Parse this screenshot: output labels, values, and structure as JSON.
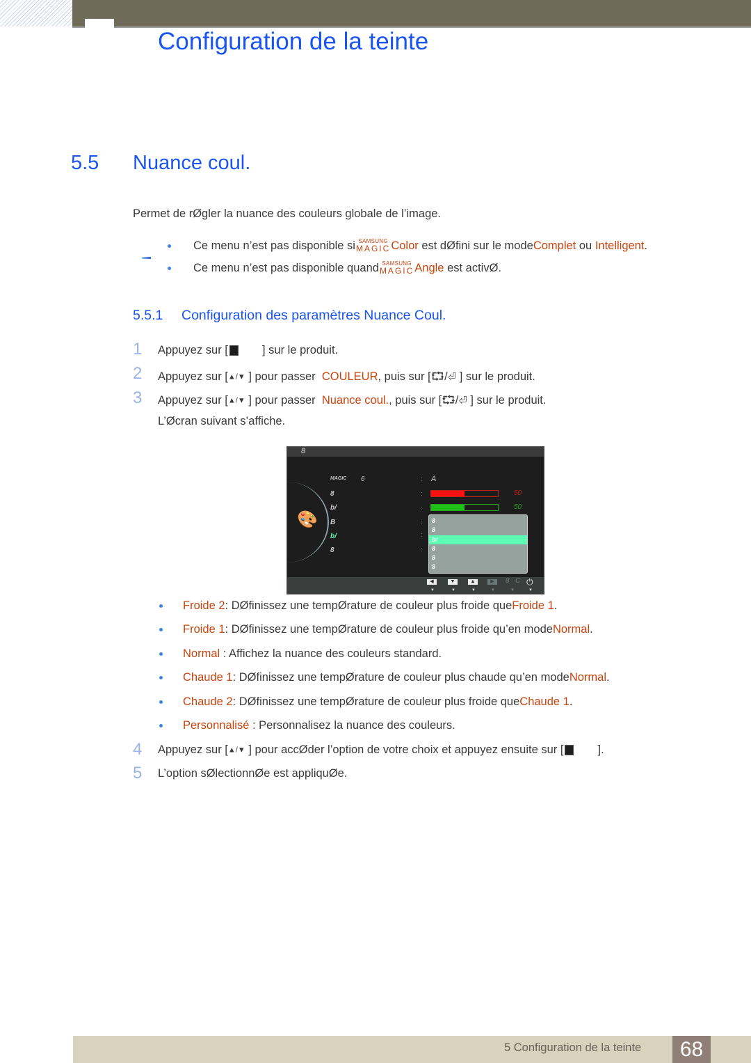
{
  "header": {
    "chapter_title": "Configuration de la teinte"
  },
  "section": {
    "number": "5.5",
    "title": "Nuance coul.",
    "intro": "Permet de rØgler la nuance des couleurs globale de l’image."
  },
  "notes": [
    {
      "pre": "Ce menu n’est pas disponible si",
      "magic_top": "SAMSUNG",
      "magic_bottom": "MAGIC",
      "feature": "Color",
      "mid": " est dØfini sur le mode",
      "opt1": "Complet",
      "between": " ou ",
      "opt2": "Intelligent",
      "end": "."
    },
    {
      "pre": "Ce menu n’est pas disponible quand",
      "magic_top": "SAMSUNG",
      "magic_bottom": "MAGIC",
      "feature": "Angle",
      "mid": " est activØ."
    }
  ],
  "subsection": {
    "number": "5.5.1",
    "title": "Configuration des paramètres Nuance Coul."
  },
  "steps": [
    {
      "num": "1",
      "pre": "Appuyez sur [",
      "post": "       ] sur le produit."
    },
    {
      "num": "2",
      "pre": "Appuyez sur [",
      "mid": "] pour passer ",
      "hl": "COULEUR",
      "post": ", puis sur [",
      "end": "] sur le produit."
    },
    {
      "num": "3",
      "pre": "Appuyez sur [",
      "mid": "] pour passer ",
      "hl": "Nuance coul.",
      "post": ", puis sur [",
      "end": "] sur le produit.",
      "line2": "L’Øcran suivant s’affiche."
    },
    {
      "num": "4",
      "pre": "Appuyez sur [",
      "mid": "] pour accØder l’option de votre choix et appuyez ensuite sur [",
      "end": "       ]."
    },
    {
      "num": "5",
      "text": "L’option sØlectionnØe est appliquØe."
    }
  ],
  "icons": {
    "updown": "▲/▼",
    "source_enter": "⮔/⏎"
  },
  "osd": {
    "header_glyph": "8",
    "menu_items": [
      "MAGIC",
      "8",
      "b/",
      "B",
      "b/",
      "8"
    ],
    "active_item_index": 4,
    "value_a": "A",
    "label_6": "6",
    "red_bar": {
      "value": 50,
      "max": 100,
      "label": "50"
    },
    "green_bar": {
      "value": 50,
      "max": 100,
      "label": "50"
    },
    "dropdown_items": [
      "8",
      "8",
      "b/",
      "8",
      "8",
      "8"
    ],
    "dropdown_selected_index": 2,
    "footer_buttons": [
      "◀",
      "▼",
      "▲",
      "▶"
    ],
    "footer_misc": [
      "8",
      "C"
    ],
    "power": "⏻",
    "colors": {
      "red": "#ff1111",
      "green": "#22c11a",
      "highlight": "#5dfdb6"
    }
  },
  "options": [
    {
      "name": "Froide 2",
      "desc": ": DØfinissez une tempØrature de couleur plus froide que",
      "ref": "Froide 1",
      "end": "."
    },
    {
      "name": "Froide 1",
      "desc": ": DØfinissez une tempØrature de couleur plus froide qu’en mode",
      "ref": "Normal",
      "end": "."
    },
    {
      "name": "Normal",
      "desc": " : Affichez la nuance des couleurs standard."
    },
    {
      "name": "Chaude 1",
      "desc": ": DØfinissez une tempØrature de couleur plus chaude qu’en mode",
      "ref": "Normal",
      "end": "."
    },
    {
      "name": "Chaude 2",
      "desc": ": DØfinissez une tempØrature de couleur plus froide que",
      "ref": "Chaude 1",
      "end": "."
    },
    {
      "name": "Personnalisé",
      "desc": " : Personnalisez la nuance des couleurs."
    }
  ],
  "footer": {
    "text": "5 Configuration de la teinte",
    "page": "68"
  },
  "colors": {
    "heading_blue": "#1a55f0",
    "highlight_orange": "#c8440e",
    "topbar": "#6e6c59",
    "footer_bar": "#d9d3bd",
    "footer_page_bg": "#8f7f76"
  }
}
